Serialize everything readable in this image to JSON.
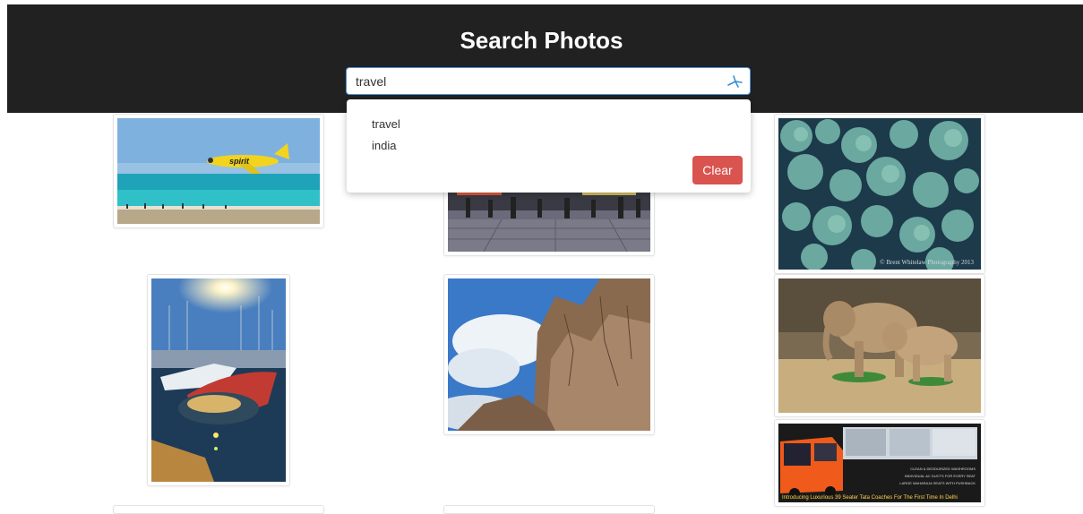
{
  "header": {
    "title": "Search Photos"
  },
  "search": {
    "value": "travel",
    "placeholder": ""
  },
  "dropdown": {
    "suggestions": [
      "travel",
      "india"
    ],
    "clear_label": "Clear"
  },
  "photos": [
    {
      "id": "plane",
      "subject": "airplane-over-beach"
    },
    {
      "id": "street",
      "subject": "street-crowd"
    },
    {
      "id": "coral",
      "subject": "coral-reef",
      "watermark": "© Brent Whitelaw Photography 2013"
    },
    {
      "id": "boats",
      "subject": "harbor-boats"
    },
    {
      "id": "rock",
      "subject": "rock-formation"
    },
    {
      "id": "elephants",
      "subject": "elephants"
    },
    {
      "id": "bus",
      "subject": "bus-advert",
      "caption": "Introducing Luxurious 39 Seater Tata Coaches For The First Time In Delhi",
      "features": [
        "CLEAN & DEODURIZED WASHROOMS",
        "INDIVIDUAL AC DUCTS FOR EVERY SEAT",
        "LARGE MAHARAJA SEATS WITH PUSHBACK"
      ]
    }
  ],
  "colors": {
    "header_bg": "#212121",
    "clear_button": "#d9534f",
    "search_border": "#4a90d9"
  }
}
